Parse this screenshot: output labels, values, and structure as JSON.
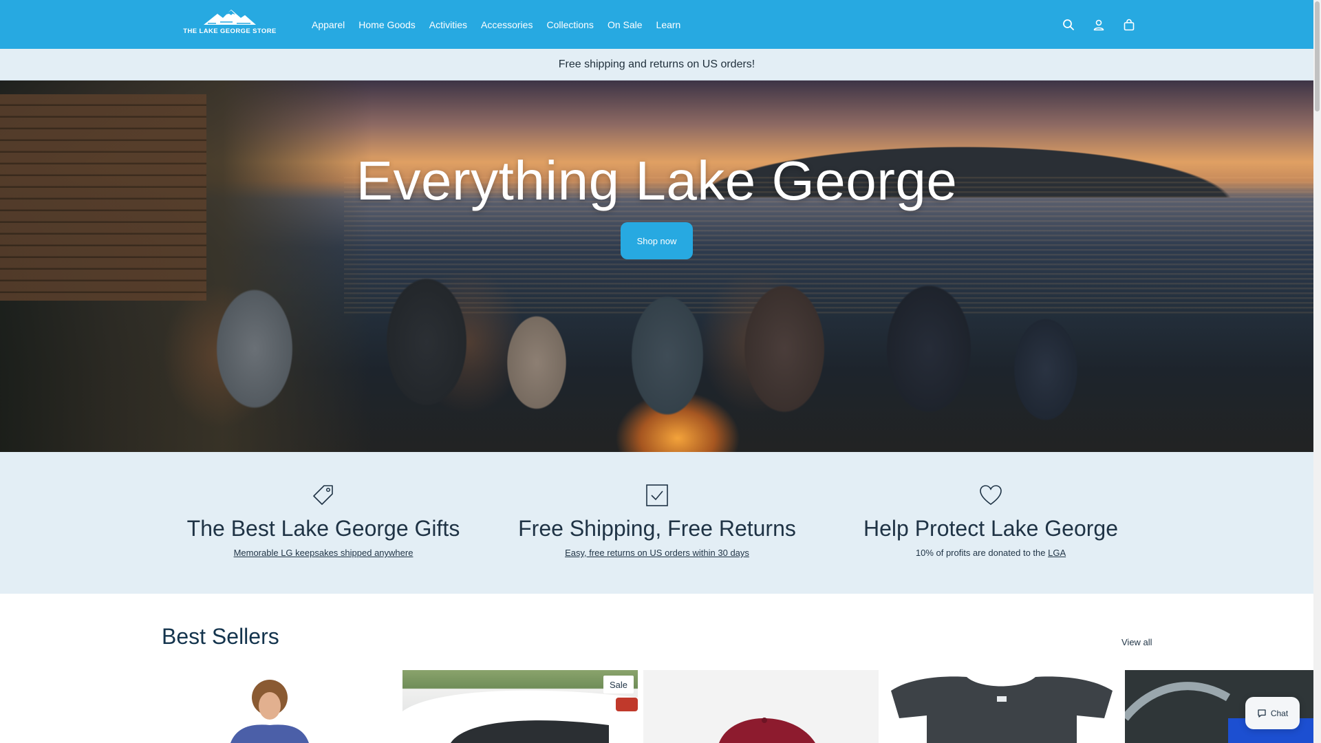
{
  "header": {
    "logo_text": "THE LAKE GEORGE STORE",
    "nav": [
      "Apparel",
      "Home Goods",
      "Activities",
      "Accessories",
      "Collections",
      "On Sale",
      "Learn"
    ],
    "icons": [
      "search-icon",
      "account-icon",
      "cart-icon"
    ],
    "bg_color": "#27a9e1"
  },
  "announcement": {
    "text": "Free shipping and returns on US orders!"
  },
  "hero": {
    "title": "Everything Lake George",
    "button": "Shop now"
  },
  "features": [
    {
      "icon": "tag-icon",
      "title": "The Best Lake George Gifts",
      "text_prefix": "",
      "link": "Memorable LG keepsakes shipped anywhere"
    },
    {
      "icon": "checkbox-icon",
      "title": "Free Shipping, Free Returns",
      "text_prefix": "",
      "link": "Easy, free returns on US orders within 30 days"
    },
    {
      "icon": "heart-icon",
      "title": "Help Protect Lake George",
      "text_prefix": "10% of profits are donated to the ",
      "link": "LGA"
    }
  ],
  "best_sellers": {
    "title": "Best Sellers",
    "view_all": "View all",
    "sale_badge": "Sale"
  },
  "chat": {
    "label": "Chat"
  }
}
